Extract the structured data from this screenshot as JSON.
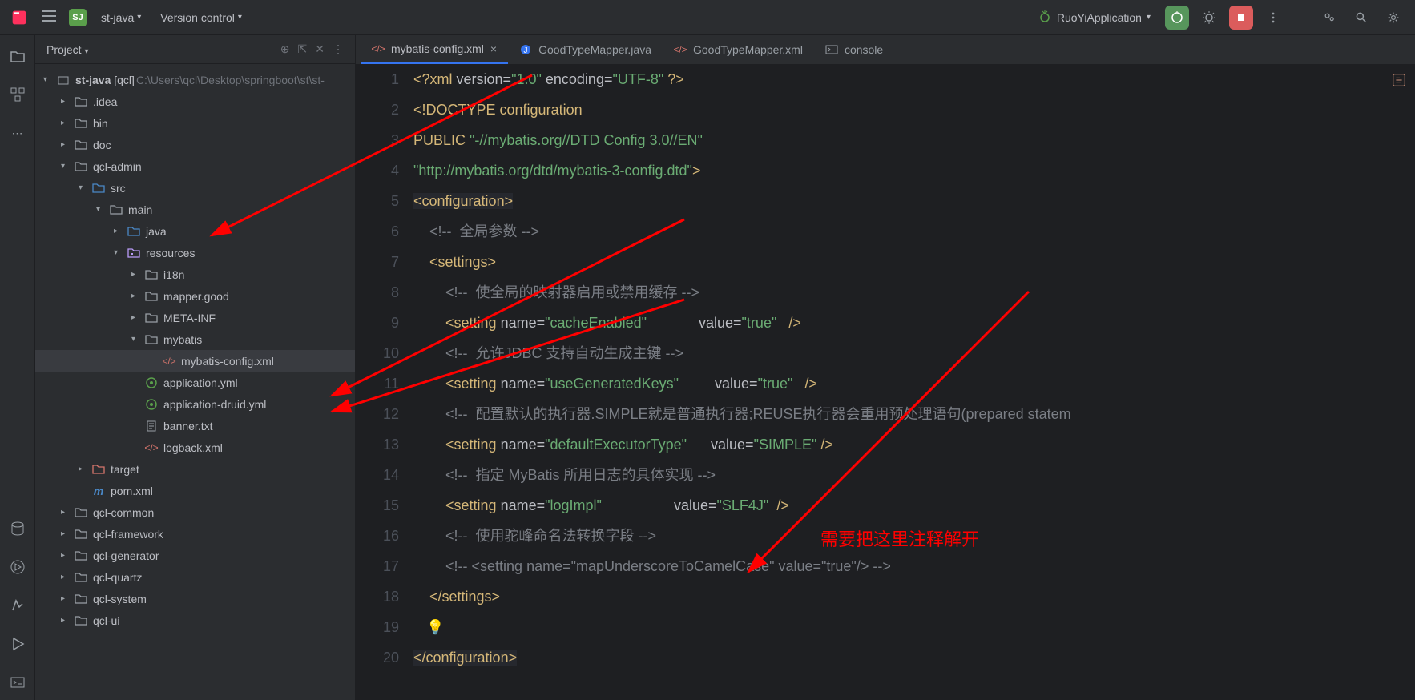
{
  "topbar": {
    "project_name": "st-java",
    "project_badge": "SJ",
    "vcs": "Version control",
    "run_config": "RuoYiApplication"
  },
  "sidebar": {
    "title": "Project",
    "root": {
      "label": "st-java",
      "suffix": " [qcl]",
      "path": " C:\\Users\\qcl\\Desktop\\springboot\\st\\st-"
    },
    "nodes": [
      {
        "indent": 1,
        "chev": ">",
        "icon": "folder",
        "label": ".idea"
      },
      {
        "indent": 1,
        "chev": ">",
        "icon": "folder",
        "label": "bin"
      },
      {
        "indent": 1,
        "chev": ">",
        "icon": "folder",
        "label": "doc"
      },
      {
        "indent": 1,
        "chev": "v",
        "icon": "folder",
        "label": "qcl-admin"
      },
      {
        "indent": 2,
        "chev": "v",
        "icon": "folder-src",
        "label": "src"
      },
      {
        "indent": 3,
        "chev": "v",
        "icon": "folder",
        "label": "main"
      },
      {
        "indent": 4,
        "chev": ">",
        "icon": "folder-src",
        "label": "java"
      },
      {
        "indent": 4,
        "chev": "v",
        "icon": "folder-res",
        "label": "resources"
      },
      {
        "indent": 5,
        "chev": ">",
        "icon": "folder",
        "label": "i18n"
      },
      {
        "indent": 5,
        "chev": ">",
        "icon": "folder",
        "label": "mapper.good"
      },
      {
        "indent": 5,
        "chev": ">",
        "icon": "folder",
        "label": "META-INF"
      },
      {
        "indent": 5,
        "chev": "v",
        "icon": "folder",
        "label": "mybatis"
      },
      {
        "indent": 6,
        "chev": "",
        "icon": "xml",
        "label": "mybatis-config.xml",
        "selected": true
      },
      {
        "indent": 5,
        "chev": "",
        "icon": "yml",
        "label": "application.yml"
      },
      {
        "indent": 5,
        "chev": "",
        "icon": "yml",
        "label": "application-druid.yml"
      },
      {
        "indent": 5,
        "chev": "",
        "icon": "txt",
        "label": "banner.txt"
      },
      {
        "indent": 5,
        "chev": "",
        "icon": "xml",
        "label": "logback.xml"
      },
      {
        "indent": 2,
        "chev": ">",
        "icon": "folder-target",
        "label": "target"
      },
      {
        "indent": 2,
        "chev": "",
        "icon": "maven",
        "label": "pom.xml"
      },
      {
        "indent": 1,
        "chev": ">",
        "icon": "folder",
        "label": "qcl-common"
      },
      {
        "indent": 1,
        "chev": ">",
        "icon": "folder",
        "label": "qcl-framework"
      },
      {
        "indent": 1,
        "chev": ">",
        "icon": "folder",
        "label": "qcl-generator"
      },
      {
        "indent": 1,
        "chev": ">",
        "icon": "folder",
        "label": "qcl-quartz"
      },
      {
        "indent": 1,
        "chev": ">",
        "icon": "folder",
        "label": "qcl-system"
      },
      {
        "indent": 1,
        "chev": ">",
        "icon": "folder",
        "label": "qcl-ui"
      }
    ]
  },
  "tabs": [
    {
      "icon": "xml",
      "label": "mybatis-config.xml",
      "active": true,
      "closable": true
    },
    {
      "icon": "java",
      "label": "GoodTypeMapper.java"
    },
    {
      "icon": "xml",
      "label": "GoodTypeMapper.xml"
    },
    {
      "icon": "console",
      "label": "console"
    }
  ],
  "chart_data": {
    "type": "table",
    "title": "mybatis-config.xml source code",
    "lines": [
      {
        "n": 1,
        "tokens": [
          [
            "tag",
            "<?xml "
          ],
          [
            "attr",
            "version="
          ],
          [
            "str",
            "\"1.0\""
          ],
          [
            "attr",
            " encoding="
          ],
          [
            "str",
            "\"UTF-8\""
          ],
          [
            "tag",
            " ?>"
          ]
        ]
      },
      {
        "n": 2,
        "tokens": [
          [
            "doctype",
            "<!DOCTYPE configuration"
          ]
        ]
      },
      {
        "n": 3,
        "tokens": [
          [
            "doctype",
            "PUBLIC "
          ],
          [
            "str",
            "\"-//mybatis.org//DTD Config 3.0//EN\""
          ]
        ]
      },
      {
        "n": 4,
        "tokens": [
          [
            "str",
            "\"http://mybatis.org/dtd/mybatis-3-config.dtd\""
          ],
          [
            "doctype",
            ">"
          ]
        ]
      },
      {
        "n": 5,
        "tokens": [
          [
            "tag",
            "<configuration>"
          ]
        ],
        "hl": true
      },
      {
        "n": 6,
        "tokens": [
          [
            "plain",
            "    "
          ],
          [
            "comm",
            "<!--  全局参数 -->"
          ]
        ]
      },
      {
        "n": 7,
        "tokens": [
          [
            "plain",
            "    "
          ],
          [
            "tag",
            "<settings>"
          ]
        ]
      },
      {
        "n": 8,
        "tokens": [
          [
            "plain",
            "        "
          ],
          [
            "comm",
            "<!--  使全局的映射器启用或禁用缓存 -->"
          ]
        ]
      },
      {
        "n": 9,
        "tokens": [
          [
            "plain",
            "        "
          ],
          [
            "tag",
            "<setting "
          ],
          [
            "attr",
            "name="
          ],
          [
            "str",
            "\"cacheEnabled\""
          ],
          [
            "plain",
            "             "
          ],
          [
            "attr",
            "value="
          ],
          [
            "str",
            "\"true\""
          ],
          [
            "plain",
            "   "
          ],
          [
            "tag",
            "/>"
          ]
        ]
      },
      {
        "n": 10,
        "tokens": [
          [
            "plain",
            "        "
          ],
          [
            "comm",
            "<!--  允许JDBC 支持自动生成主键 -->"
          ]
        ]
      },
      {
        "n": 11,
        "tokens": [
          [
            "plain",
            "        "
          ],
          [
            "tag",
            "<setting "
          ],
          [
            "attr",
            "name="
          ],
          [
            "str",
            "\"useGeneratedKeys\""
          ],
          [
            "plain",
            "         "
          ],
          [
            "attr",
            "value="
          ],
          [
            "str",
            "\"true\""
          ],
          [
            "plain",
            "   "
          ],
          [
            "tag",
            "/>"
          ]
        ]
      },
      {
        "n": 12,
        "tokens": [
          [
            "plain",
            "        "
          ],
          [
            "comm",
            "<!--  配置默认的执行器.SIMPLE就是普通执行器;REUSE执行器会重用预处理语句(prepared statem"
          ]
        ]
      },
      {
        "n": 13,
        "tokens": [
          [
            "plain",
            "        "
          ],
          [
            "tag",
            "<setting "
          ],
          [
            "attr",
            "name="
          ],
          [
            "str",
            "\"defaultExecutorType\""
          ],
          [
            "plain",
            "      "
          ],
          [
            "attr",
            "value="
          ],
          [
            "str",
            "\"SIMPLE\""
          ],
          [
            "tag",
            " />"
          ]
        ]
      },
      {
        "n": 14,
        "tokens": [
          [
            "plain",
            "        "
          ],
          [
            "comm",
            "<!--  指定 MyBatis 所用日志的具体实现 -->"
          ]
        ]
      },
      {
        "n": 15,
        "tokens": [
          [
            "plain",
            "        "
          ],
          [
            "tag",
            "<setting "
          ],
          [
            "attr",
            "name="
          ],
          [
            "str",
            "\"logImpl\""
          ],
          [
            "plain",
            "                  "
          ],
          [
            "attr",
            "value="
          ],
          [
            "str",
            "\"SLF4J\""
          ],
          [
            "plain",
            "  "
          ],
          [
            "tag",
            "/>"
          ]
        ]
      },
      {
        "n": 16,
        "tokens": [
          [
            "plain",
            "        "
          ],
          [
            "comm",
            "<!--  使用驼峰命名法转换字段 -->"
          ]
        ]
      },
      {
        "n": 17,
        "tokens": [
          [
            "plain",
            "        "
          ],
          [
            "comm",
            "<!-- <setting name=\"mapUnderscoreToCamelCase\" value=\"true\"/> -->"
          ]
        ]
      },
      {
        "n": 18,
        "tokens": [
          [
            "plain",
            "    "
          ],
          [
            "tag",
            "</settings>"
          ]
        ]
      },
      {
        "n": 19,
        "tokens": [
          [
            "plain",
            ""
          ]
        ],
        "bulb": true
      },
      {
        "n": 20,
        "tokens": [
          [
            "tag",
            "</configuration>"
          ]
        ],
        "hl": true
      }
    ]
  },
  "annotation": {
    "text": "需要把这里注释解开"
  }
}
